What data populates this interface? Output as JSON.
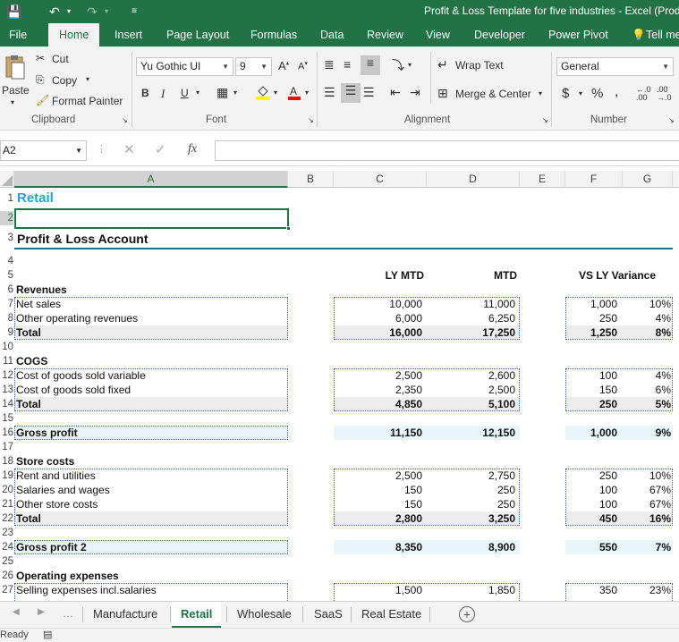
{
  "window": {
    "title": "Profit & Loss Template for five industries - Excel (Prod"
  },
  "ribbon_tabs": [
    "File",
    "Home",
    "Insert",
    "Page Layout",
    "Formulas",
    "Data",
    "Review",
    "View",
    "Developer",
    "Power Pivot",
    "Tell me"
  ],
  "active_ribbon_tab": "Home",
  "clipboard": {
    "paste": "Paste",
    "cut": "Cut",
    "copy": "Copy",
    "format_painter": "Format Painter",
    "label": "Clipboard"
  },
  "font": {
    "name": "Yu Gothic UI",
    "size": "9",
    "bold": "B",
    "italic": "I",
    "underline": "U",
    "label": "Font"
  },
  "alignment": {
    "wrap_text": "Wrap Text",
    "merge_center": "Merge & Center",
    "label": "Alignment"
  },
  "number": {
    "format": "General",
    "currency": "$",
    "percent": "%",
    "comma": ",",
    "label": "Number"
  },
  "formula_bar": {
    "name_box": "A2",
    "fx": "fx",
    "value": ""
  },
  "columns": [
    "A",
    "B",
    "C",
    "D",
    "E",
    "F",
    "G"
  ],
  "active_column": "A",
  "row_numbers": [
    "1",
    "2",
    "3",
    "4",
    "5",
    "6",
    "7",
    "8",
    "9",
    "10",
    "11",
    "12",
    "13",
    "14",
    "15",
    "16",
    "17",
    "18",
    "19",
    "20",
    "21",
    "22",
    "23",
    "24",
    "25",
    "26",
    "27"
  ],
  "sheet": {
    "title": "Retail",
    "subtitle": "Profit & Loss Account",
    "headers": {
      "ly_mtd": "LY MTD",
      "mtd": "MTD",
      "variance": "VS LY Variance"
    },
    "sections": {
      "revenues": "Revenues",
      "cogs": "COGS",
      "store_costs": "Store costs",
      "operating_expenses": "Operating expenses"
    },
    "rows": [
      {
        "label": "Net sales",
        "ly": "10,000",
        "mtd": "11,000",
        "var": "1,000",
        "pct": "10%"
      },
      {
        "label": "Other operating revenues",
        "ly": "6,000",
        "mtd": "6,250",
        "var": "250",
        "pct": "4%"
      },
      {
        "label": "Total",
        "ly": "16,000",
        "mtd": "17,250",
        "var": "1,250",
        "pct": "8%"
      },
      {
        "label": "Cost of goods sold variable",
        "ly": "2,500",
        "mtd": "2,600",
        "var": "100",
        "pct": "4%"
      },
      {
        "label": "Cost of goods sold fixed",
        "ly": "2,350",
        "mtd": "2,500",
        "var": "150",
        "pct": "6%"
      },
      {
        "label": "Total",
        "ly": "4,850",
        "mtd": "5,100",
        "var": "250",
        "pct": "5%"
      },
      {
        "label": "Gross profit",
        "ly": "11,150",
        "mtd": "12,150",
        "var": "1,000",
        "pct": "9%"
      },
      {
        "label": "Rent and utilities",
        "ly": "2,500",
        "mtd": "2,750",
        "var": "250",
        "pct": "10%"
      },
      {
        "label": "Salaries and wages",
        "ly": "150",
        "mtd": "250",
        "var": "100",
        "pct": "67%"
      },
      {
        "label": "Other store costs",
        "ly": "150",
        "mtd": "250",
        "var": "100",
        "pct": "67%"
      },
      {
        "label": "Total",
        "ly": "2,800",
        "mtd": "3,250",
        "var": "450",
        "pct": "16%"
      },
      {
        "label": "Gross profit 2",
        "ly": "8,350",
        "mtd": "8,900",
        "var": "550",
        "pct": "7%"
      },
      {
        "label": "Selling expenses incl.salaries",
        "ly": "1,500",
        "mtd": "1,850",
        "var": "350",
        "pct": "23%"
      }
    ]
  },
  "sheet_tabs": [
    "Manufacture",
    "Retail",
    "Wholesale",
    "SaaS",
    "Real Estate"
  ],
  "active_sheet": "Retail",
  "status": "Ready",
  "colors": {
    "excel_green": "#217346",
    "title_blue": "#2aa3c8",
    "gp_fill": "#e9f4f9",
    "total_fill": "#ededed"
  }
}
